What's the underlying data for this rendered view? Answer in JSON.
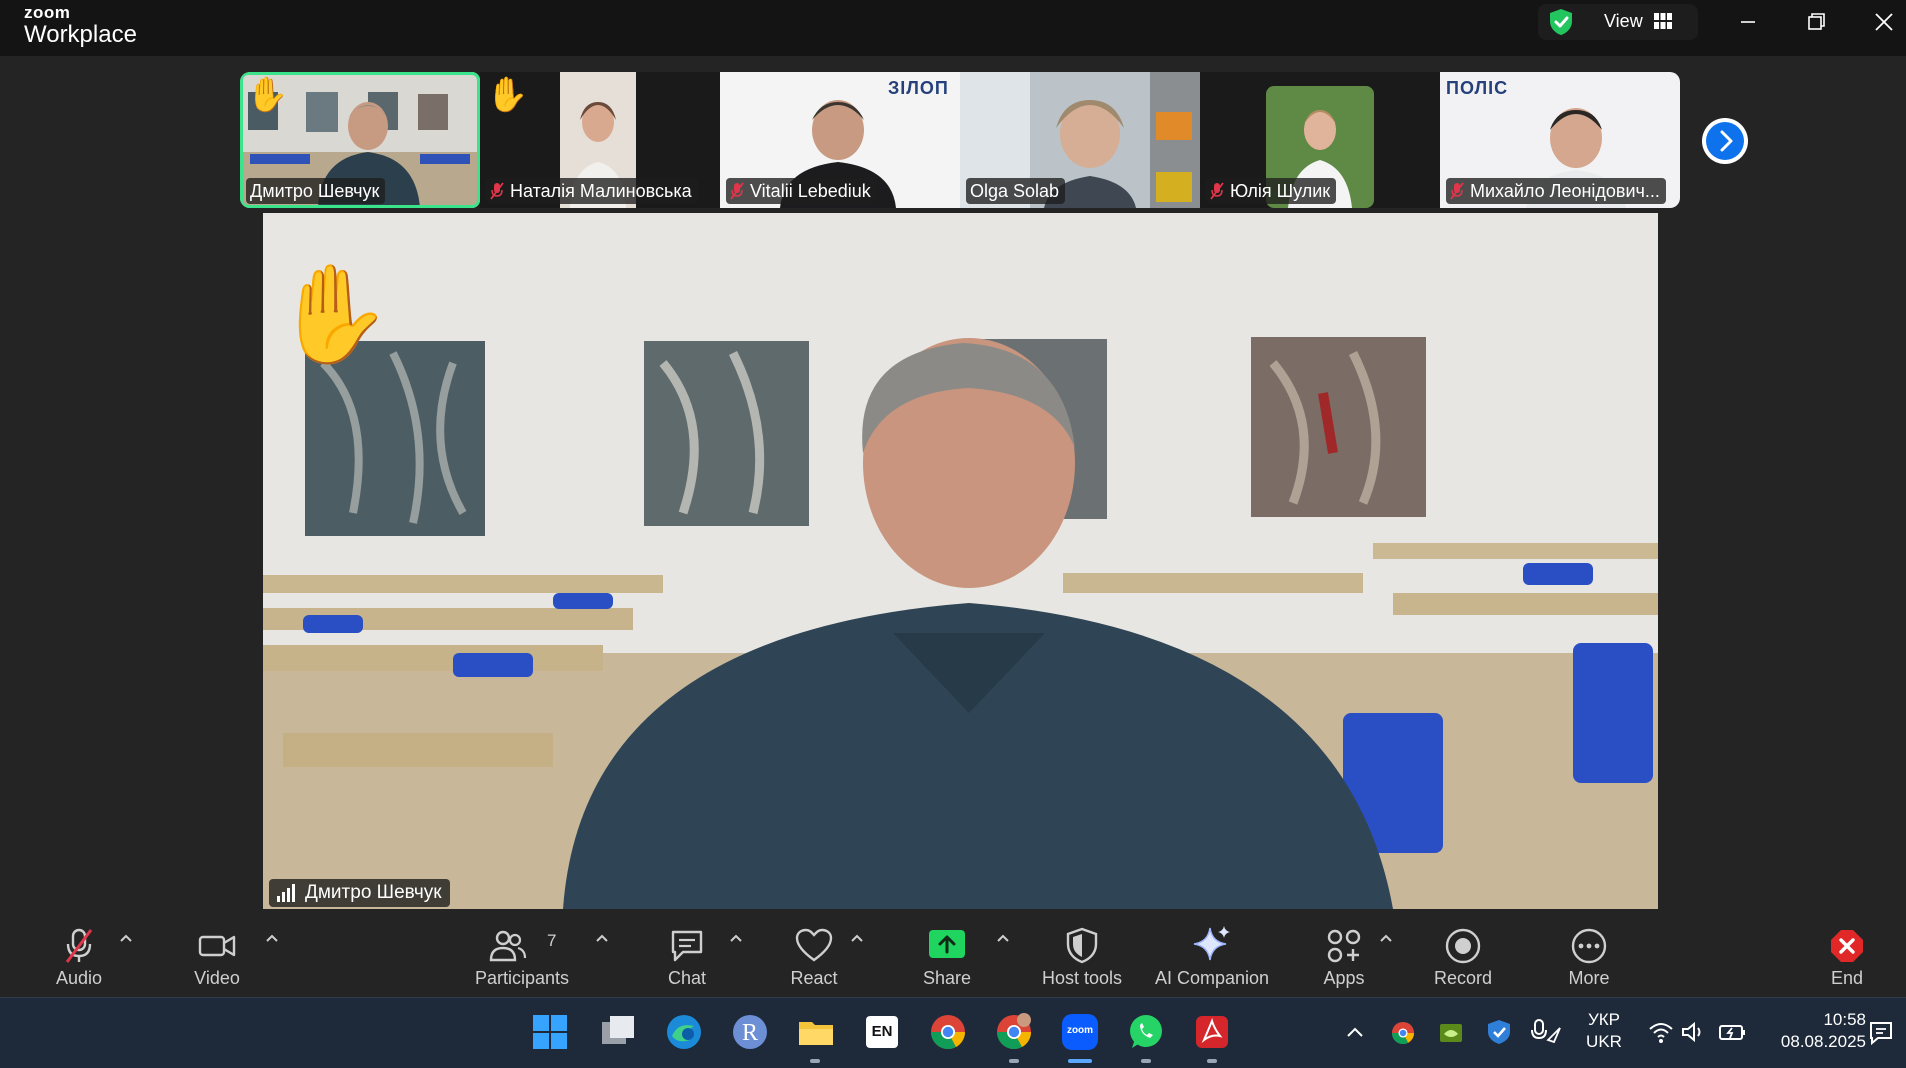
{
  "titlebar": {
    "brand_small": "zoom",
    "brand_large": "Workplace",
    "view_label": "View"
  },
  "filmstrip": {
    "tiles": [
      {
        "name": "Дмитро Шевчук",
        "muted": false,
        "hand_raised": true,
        "active": true
      },
      {
        "name": "Наталія Малиновська",
        "muted": true,
        "hand_raised": true,
        "active": false
      },
      {
        "name": "Vitalii Lebediuk",
        "muted": true,
        "hand_raised": false,
        "active": false,
        "logo": "ЗІЛОП"
      },
      {
        "name": "Olga Solab",
        "muted": false,
        "hand_raised": false,
        "active": false
      },
      {
        "name": "Юлія Шулик",
        "muted": true,
        "hand_raised": false,
        "active": false
      },
      {
        "name": "Михайло Леонідович...",
        "muted": true,
        "hand_raised": false,
        "active": false,
        "logo": "ПОЛІС"
      }
    ]
  },
  "main_video": {
    "speaker_name": "Дмитро Шевчук",
    "hand_raised": true
  },
  "toolbar": {
    "audio": "Audio",
    "video": "Video",
    "participants": "Participants",
    "participants_count": "7",
    "chat": "Chat",
    "react": "React",
    "share": "Share",
    "host_tools": "Host tools",
    "ai_companion": "AI Companion",
    "apps": "Apps",
    "record": "Record",
    "more": "More",
    "end": "End"
  },
  "colors": {
    "active_border": "#3be38a",
    "share_green": "#1fd45f",
    "end_red": "#e02828",
    "mute_red": "#e0364a"
  },
  "taskbar": {
    "lang_tile": "EN",
    "r_app": "R",
    "zoom_app": "zoom",
    "keyboard_layout_top": "УКР",
    "keyboard_layout_bottom": "UKR",
    "time": "10:58",
    "date": "08.08.2025"
  }
}
